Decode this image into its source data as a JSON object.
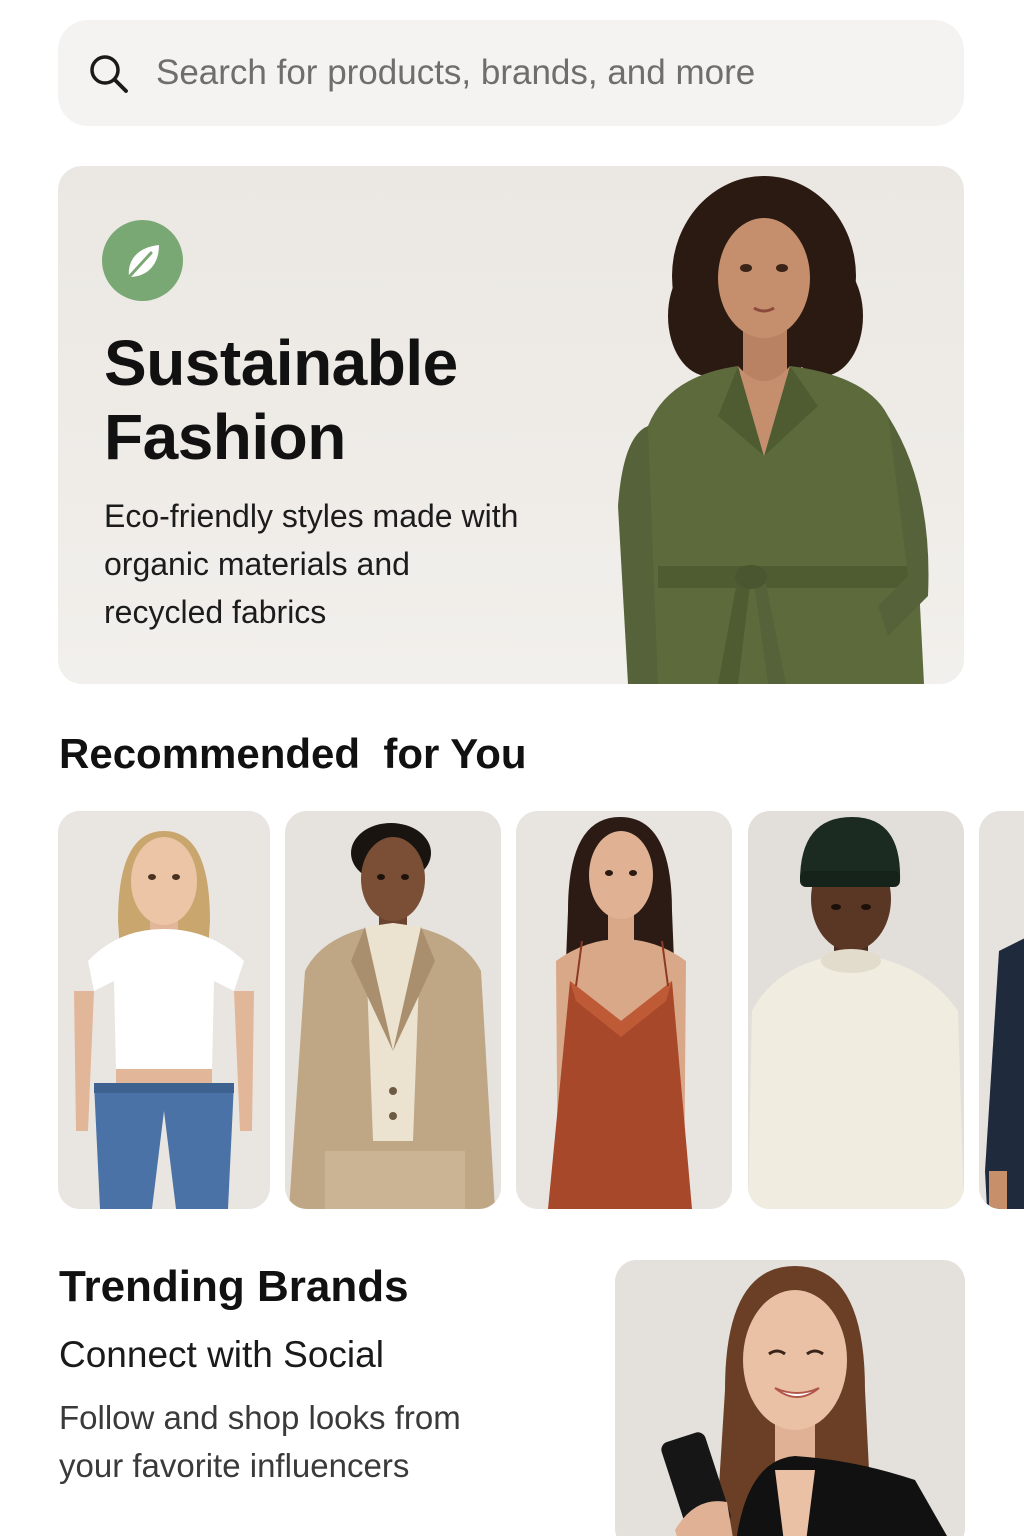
{
  "search": {
    "placeholder": "Search for products, brands, and more"
  },
  "hero": {
    "title_line1": "Sustainable",
    "title_line2": "Fashion",
    "subtitle_line1": "Eco-friendly styles made with",
    "subtitle_line2": "organic materials and",
    "subtitle_line3": "recycled fabrics",
    "badge_icon": "leaf-icon",
    "badge_color": "#7aa874"
  },
  "recommended": {
    "title": "Recommended  for You",
    "items": [
      {
        "name": "white-tee-jeans-look",
        "top_color": "#ffffff",
        "bottom_color": "#4b72a6"
      },
      {
        "name": "tan-suit-look",
        "top_color": "#bfa685",
        "bottom_color": "#bfa685"
      },
      {
        "name": "rust-slip-dress-look",
        "top_color": "#a8482a",
        "bottom_color": "#a8482a"
      },
      {
        "name": "cream-sweater-beanie-look",
        "top_color": "#f0ece0",
        "bottom_color": "#f0ece0"
      },
      {
        "name": "navy-blazer-look",
        "top_color": "#1f2a3c",
        "bottom_color": "#1f2a3c"
      }
    ]
  },
  "trending": {
    "title": "Trending Brands",
    "subtitle": "Connect with Social",
    "desc_line1": "Follow and shop looks from",
    "desc_line2": "your favorite influencers"
  },
  "colors": {
    "accent_green": "#7aa874",
    "coat_green": "#5d6b3c"
  }
}
